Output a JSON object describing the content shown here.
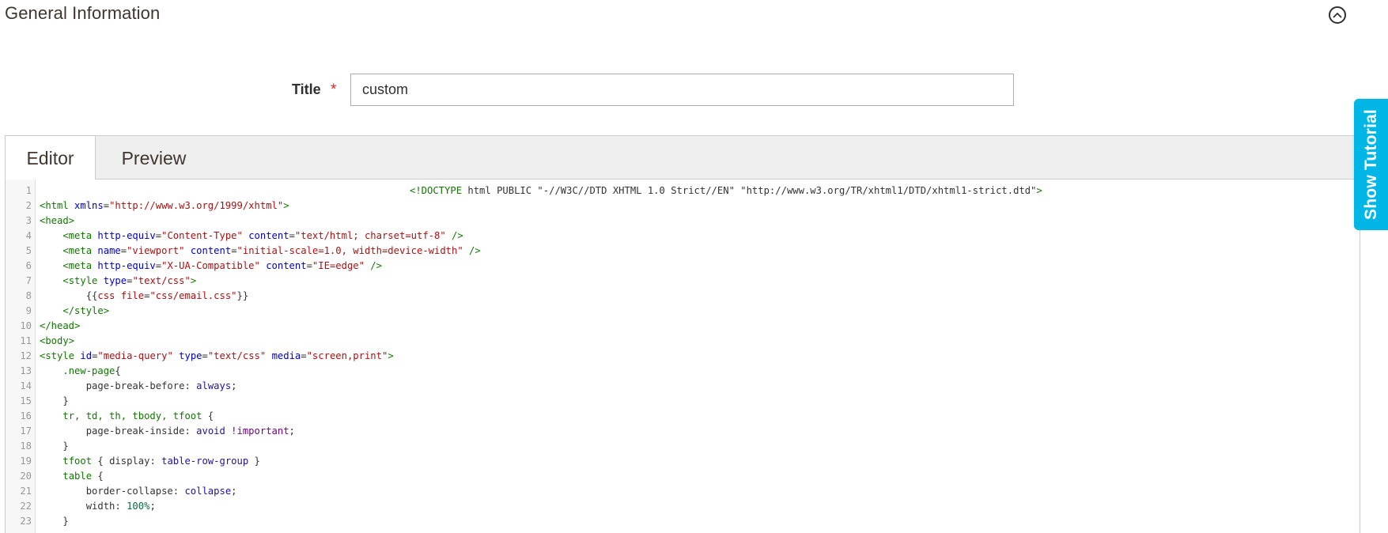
{
  "section": {
    "title": "General Information"
  },
  "form": {
    "title_label": "Title",
    "required_mark": "*",
    "title_value": "custom"
  },
  "tabs": [
    {
      "label": "Editor",
      "active": true
    },
    {
      "label": "Preview",
      "active": false
    }
  ],
  "tutorial": {
    "label": "Show Tutorial"
  },
  "colors": {
    "accent": "#00b6e6",
    "required": "#e22626"
  },
  "code_lines": [
    {
      "n": "1",
      "text": "<!DOCTYPE html PUBLIC \"-//W3C//DTD XHTML 1.0 Strict//EN\" \"http://www.w3.org/TR/xhtml1/DTD/xhtml1-strict.dtd\">"
    },
    {
      "n": "2",
      "text": "<html xmlns=\"http://www.w3.org/1999/xhtml\">"
    },
    {
      "n": "3",
      "text": "<head>"
    },
    {
      "n": "4",
      "text": "    <meta http-equiv=\"Content-Type\" content=\"text/html; charset=utf-8\" />"
    },
    {
      "n": "5",
      "text": "    <meta name=\"viewport\" content=\"initial-scale=1.0, width=device-width\" />"
    },
    {
      "n": "6",
      "text": "    <meta http-equiv=\"X-UA-Compatible\" content=\"IE=edge\" />"
    },
    {
      "n": "7",
      "text": "    <style type=\"text/css\">"
    },
    {
      "n": "8",
      "text": "        {{css file=\"css/email.css\"}}"
    },
    {
      "n": "9",
      "text": "    </style>"
    },
    {
      "n": "10",
      "text": "</head>"
    },
    {
      "n": "11",
      "text": "<body>"
    },
    {
      "n": "12",
      "text": "<style id=\"media-query\" type=\"text/css\" media=\"screen,print\">"
    },
    {
      "n": "13",
      "text": "    .new-page{"
    },
    {
      "n": "14",
      "text": "        page-break-before: always;"
    },
    {
      "n": "15",
      "text": "    }"
    },
    {
      "n": "16",
      "text": "    tr, td, th, tbody, tfoot {"
    },
    {
      "n": "17",
      "text": "        page-break-inside: avoid !important;"
    },
    {
      "n": "18",
      "text": "    }"
    },
    {
      "n": "19",
      "text": "    tfoot { display: table-row-group }"
    },
    {
      "n": "20",
      "text": "    table {"
    },
    {
      "n": "21",
      "text": "        border-collapse: collapse;"
    },
    {
      "n": "22",
      "text": "        width: 100%;"
    },
    {
      "n": "23",
      "text": "    }"
    }
  ]
}
